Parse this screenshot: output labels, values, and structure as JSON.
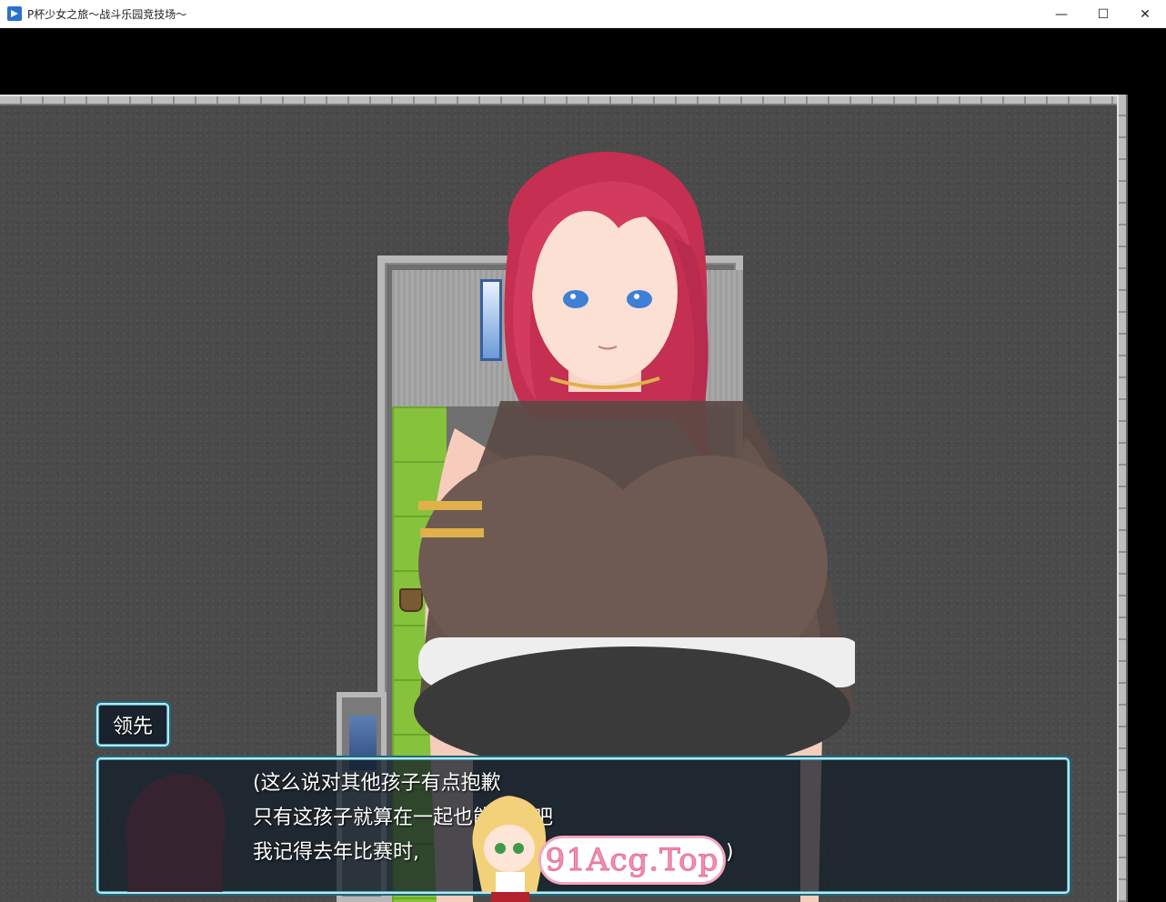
{
  "window": {
    "title": "P杯少女之旅～战斗乐园竞技场～",
    "controls": {
      "minimize": "—",
      "maximize": "☐",
      "close": "✕"
    }
  },
  "dialog": {
    "speaker_name": "领先",
    "lines": [
      "(这么说对其他孩子有点抱歉",
      "只有这孩子就算在一起也能上场吧",
      "我记得去年比赛时,"
    ],
    "trailing_char": ")"
  },
  "watermark": {
    "text": "91Acg.Top"
  },
  "colors": {
    "hair": "#d23a5e",
    "outer_floor": "#4a4a4a",
    "grass": "#86c23b",
    "dialog_border": "#bfe4ee",
    "dialog_glow": "#1b6a7a",
    "watermark_pink": "#f48fb1"
  }
}
